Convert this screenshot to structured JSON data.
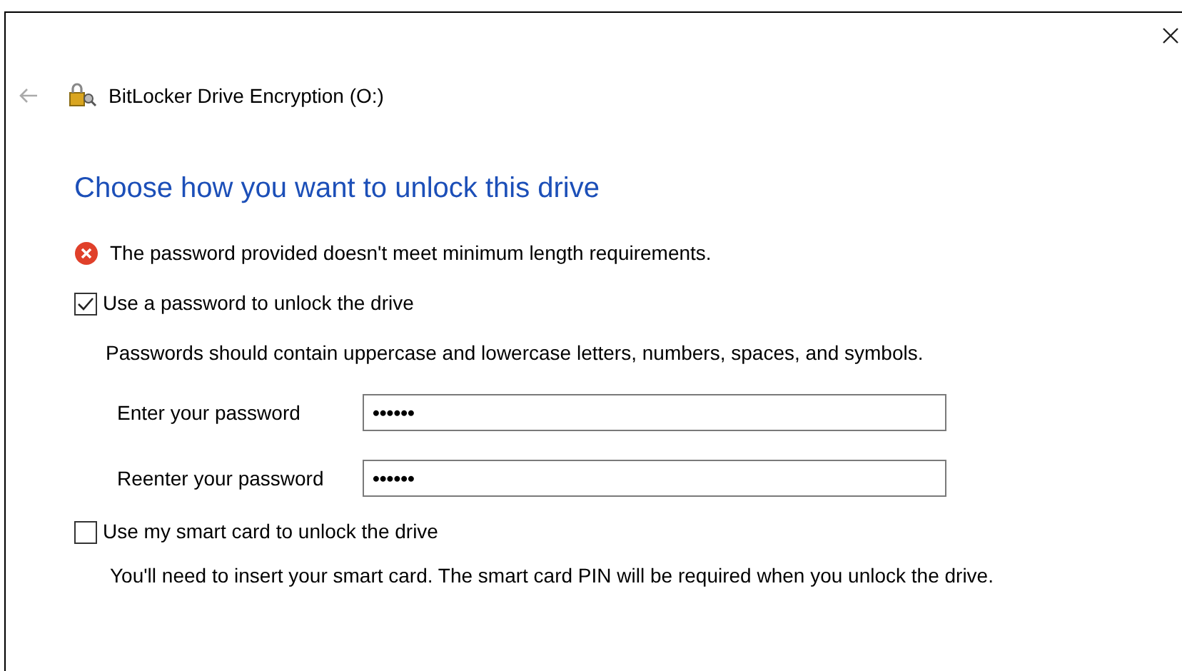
{
  "window": {
    "title": "BitLocker Drive Encryption (O:)"
  },
  "heading": "Choose how you want to unlock this drive",
  "error": "The password provided doesn't meet minimum length requirements.",
  "options": [
    {
      "label": "Use a password to unlock the drive",
      "checked": true,
      "description": "Passwords should contain uppercase and lowercase letters, numbers, spaces, and symbols.",
      "fields": [
        {
          "label": "Enter your password",
          "value": "••••••"
        },
        {
          "label": "Reenter your password",
          "value": "••••••"
        }
      ]
    },
    {
      "label": "Use my smart card to unlock the drive",
      "checked": false,
      "description": "You'll need to insert your smart card. The smart card PIN will be required when you unlock the drive."
    }
  ]
}
